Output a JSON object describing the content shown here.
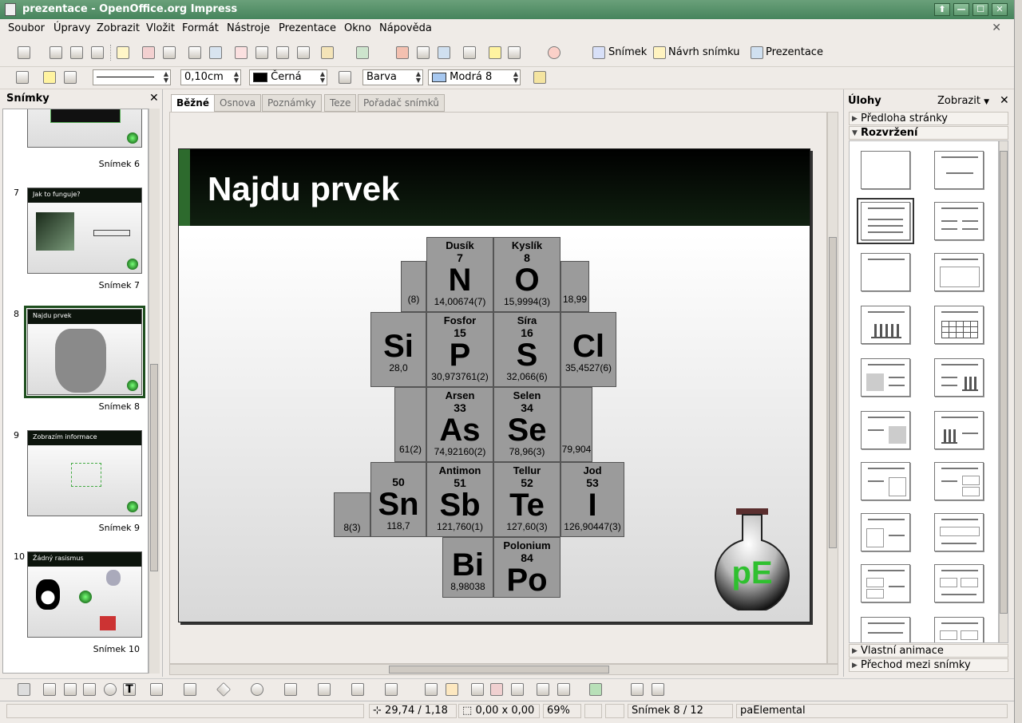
{
  "window": {
    "title": "prezentace - OpenOffice.org Impress"
  },
  "menu": [
    "Soubor",
    "Úpravy",
    "Zobrazit",
    "Vložit",
    "Formát",
    "Nástroje",
    "Prezentace",
    "Okno",
    "Nápověda"
  ],
  "toolbar": {
    "slide_label": "Snímek",
    "slide_design_label": "Návrh snímku",
    "presentation_label": "Prezentace"
  },
  "format_bar": {
    "line_width": "0,10cm",
    "line_color": "Černá",
    "area_style": "Barva",
    "area_color": "Modrá 8",
    "line_color_hex": "#000000",
    "area_color_hex": "#a7c8f0"
  },
  "slide_pane": {
    "title": "Snímky",
    "slides": [
      {
        "num": "",
        "label": "Snímek 6",
        "title": ""
      },
      {
        "num": "7",
        "label": "Snímek 7",
        "title": "Jak to funguje?"
      },
      {
        "num": "8",
        "label": "Snímek 8",
        "title": "Najdu prvek"
      },
      {
        "num": "9",
        "label": "Snímek 9",
        "title": "Zobrazím informace"
      },
      {
        "num": "10",
        "label": "Snímek 10",
        "title": "Žádný rasismus"
      }
    ]
  },
  "tabs": [
    "Běžné",
    "Osnova",
    "Poznámky",
    "Teze",
    "Pořadač snímků"
  ],
  "slide": {
    "title": "Najdu prvek",
    "logo_text": "pE",
    "elements": [
      {
        "name": "Dusík",
        "z": "7",
        "sym": "N",
        "mass": "14,00674(7)"
      },
      {
        "name": "Kyslík",
        "z": "8",
        "sym": "O",
        "mass": "15,9994(3)"
      },
      {
        "name": "Fosfor",
        "z": "15",
        "sym": "P",
        "mass": "30,973761(2)"
      },
      {
        "name": "Síra",
        "z": "16",
        "sym": "S",
        "mass": "32,066(6)"
      },
      {
        "name": "Arsen",
        "z": "33",
        "sym": "As",
        "mass": "74,92160(2)"
      },
      {
        "name": "Selen",
        "z": "34",
        "sym": "Se",
        "mass": "78,96(3)"
      },
      {
        "name": "Antimon",
        "z": "51",
        "sym": "Sb",
        "mass": "121,760(1)"
      },
      {
        "name": "Tellur",
        "z": "52",
        "sym": "Te",
        "mass": "127,60(3)"
      },
      {
        "name": "Jod",
        "z": "53",
        "sym": "I",
        "mass": "126,90447(3)"
      },
      {
        "name": "Polonium",
        "z": "84",
        "sym": "Po",
        "mass": ""
      }
    ],
    "partial": {
      "si": "Si",
      "si_mass": "28,0",
      "cl": "Cl",
      "cl_mass": "35,4527(6)",
      "ge_mass": "(8)",
      "cl_mass2": "18,99",
      "bi": "Bi",
      "bi_mass": "8,98038",
      "br_mass": "79,904",
      "sn": "Sn",
      "sn_mass": "118,7",
      "in_mass": "8(3)",
      "ge_mass2": "61(2)",
      "z50": "50"
    }
  },
  "task_pane": {
    "title": "Úlohy",
    "view": "Zobrazit",
    "sections": {
      "master": "Předloha stránky",
      "layouts": "Rozvržení",
      "animation": "Vlastní animace",
      "transition": "Přechod mezi snímky"
    }
  },
  "status": {
    "position": "29,74 / 1,18",
    "size": "0,00 x 0,00",
    "zoom": "69%",
    "slide_info": "Snímek 8 / 12",
    "master": "paElemental"
  }
}
